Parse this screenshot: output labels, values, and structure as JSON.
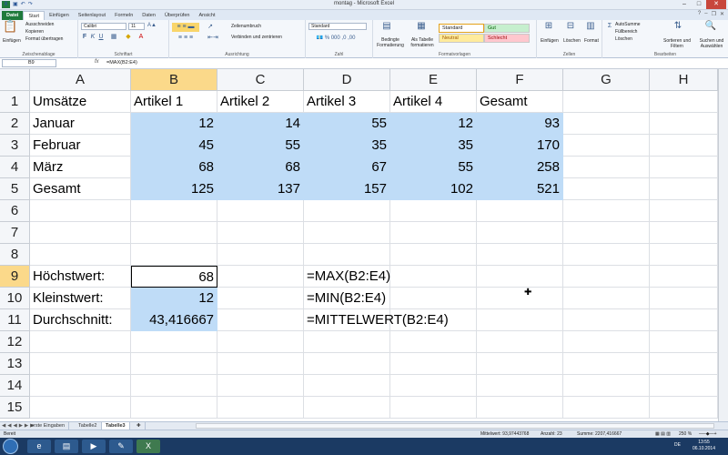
{
  "window": {
    "title": "montag - Microsoft Excel"
  },
  "qat_icons": [
    "excel-logo",
    "save-icon",
    "undo-icon",
    "redo-icon"
  ],
  "ribbon_tabs": [
    "Datei",
    "Start",
    "Einfügen",
    "Seitenlayout",
    "Formeln",
    "Daten",
    "Überprüfen",
    "Ansicht"
  ],
  "ribbon": {
    "clipboard": {
      "paste": "Einfügen",
      "cut": "Ausschneiden",
      "copy": "Kopieren",
      "format_painter": "Format übertragen",
      "label": "Zwischenablage"
    },
    "font": {
      "name": "Calibri",
      "size": "11",
      "label": "Schriftart"
    },
    "alignment": {
      "wrap": "Zeilenumbruch",
      "merge": "Verbinden und zentrieren",
      "label": "Ausrichtung"
    },
    "number": {
      "format": "Standard",
      "label": "Zahl"
    },
    "styles": {
      "cond_format": "Bedingte Formatierung",
      "as_table": "Als Tabelle formatieren",
      "standard": "Standard",
      "gut": "Gut",
      "neutral": "Neutral",
      "schlecht": "Schlecht",
      "label": "Formatvorlagen"
    },
    "cells": {
      "insert": "Einfügen",
      "delete": "Löschen",
      "format": "Format",
      "label": "Zellen"
    },
    "editing": {
      "autosum": "AutoSumme",
      "fill": "Füllbereich",
      "clear": "Löschen",
      "sort": "Sortieren und Filtern",
      "find": "Suchen und Auswählen",
      "label": "Bearbeiten"
    }
  },
  "formula_bar": {
    "name_box": "B9",
    "fx": "fx",
    "formula": "=MAX(B2:E4)"
  },
  "columns": [
    "A",
    "B",
    "C",
    "D",
    "E",
    "F",
    "G",
    "H"
  ],
  "rows": [
    "1",
    "2",
    "3",
    "4",
    "5",
    "6",
    "7",
    "8",
    "9",
    "10",
    "11",
    "12",
    "13",
    "14",
    "15"
  ],
  "cells": {
    "A1": "Umsätze",
    "B1": "Artikel 1",
    "C1": "Artikel 2",
    "D1": "Artikel 3",
    "E1": "Artikel 4",
    "F1": "Gesamt",
    "A2": "Januar",
    "B2": "12",
    "C2": "14",
    "D2": "55",
    "E2": "12",
    "F2": "93",
    "A3": "Februar",
    "B3": "45",
    "C3": "55",
    "D3": "35",
    "E3": "35",
    "F3": "170",
    "A4": "März",
    "B4": "68",
    "C4": "68",
    "D4": "67",
    "E4": "55",
    "F4": "258",
    "A5": "Gesamt",
    "B5": "125",
    "C5": "137",
    "D5": "157",
    "E5": "102",
    "F5": "521",
    "A9": "Höchstwert:",
    "B9": "68",
    "D9": "=MAX(B2:E4)",
    "A10": "Kleinstwert:",
    "B10": "12",
    "D10": "=MIN(B2:E4)",
    "A11": "Durchschnitt:",
    "B11": "43,416667",
    "D11": "=MITTELWERT(B2:E4)"
  },
  "sheet_tabs": [
    "erste Eingaben",
    "Tabelle2",
    "Tabelle3"
  ],
  "active_sheet": "Tabelle3",
  "status": {
    "ready": "Bereit",
    "average": "Mittelwert: 93,97443768",
    "count": "Anzahl: 23",
    "sum": "Summe: 2207,416667",
    "zoom": "250 %"
  },
  "taskbar": {
    "lang": "DE",
    "time": "13:55",
    "date": "06.10.2014"
  },
  "colors": {
    "highlight": "#bfdcf7",
    "header_selected": "#fbd98a",
    "excel_green": "#1f7a3c",
    "taskbar": "#1b3a63"
  }
}
